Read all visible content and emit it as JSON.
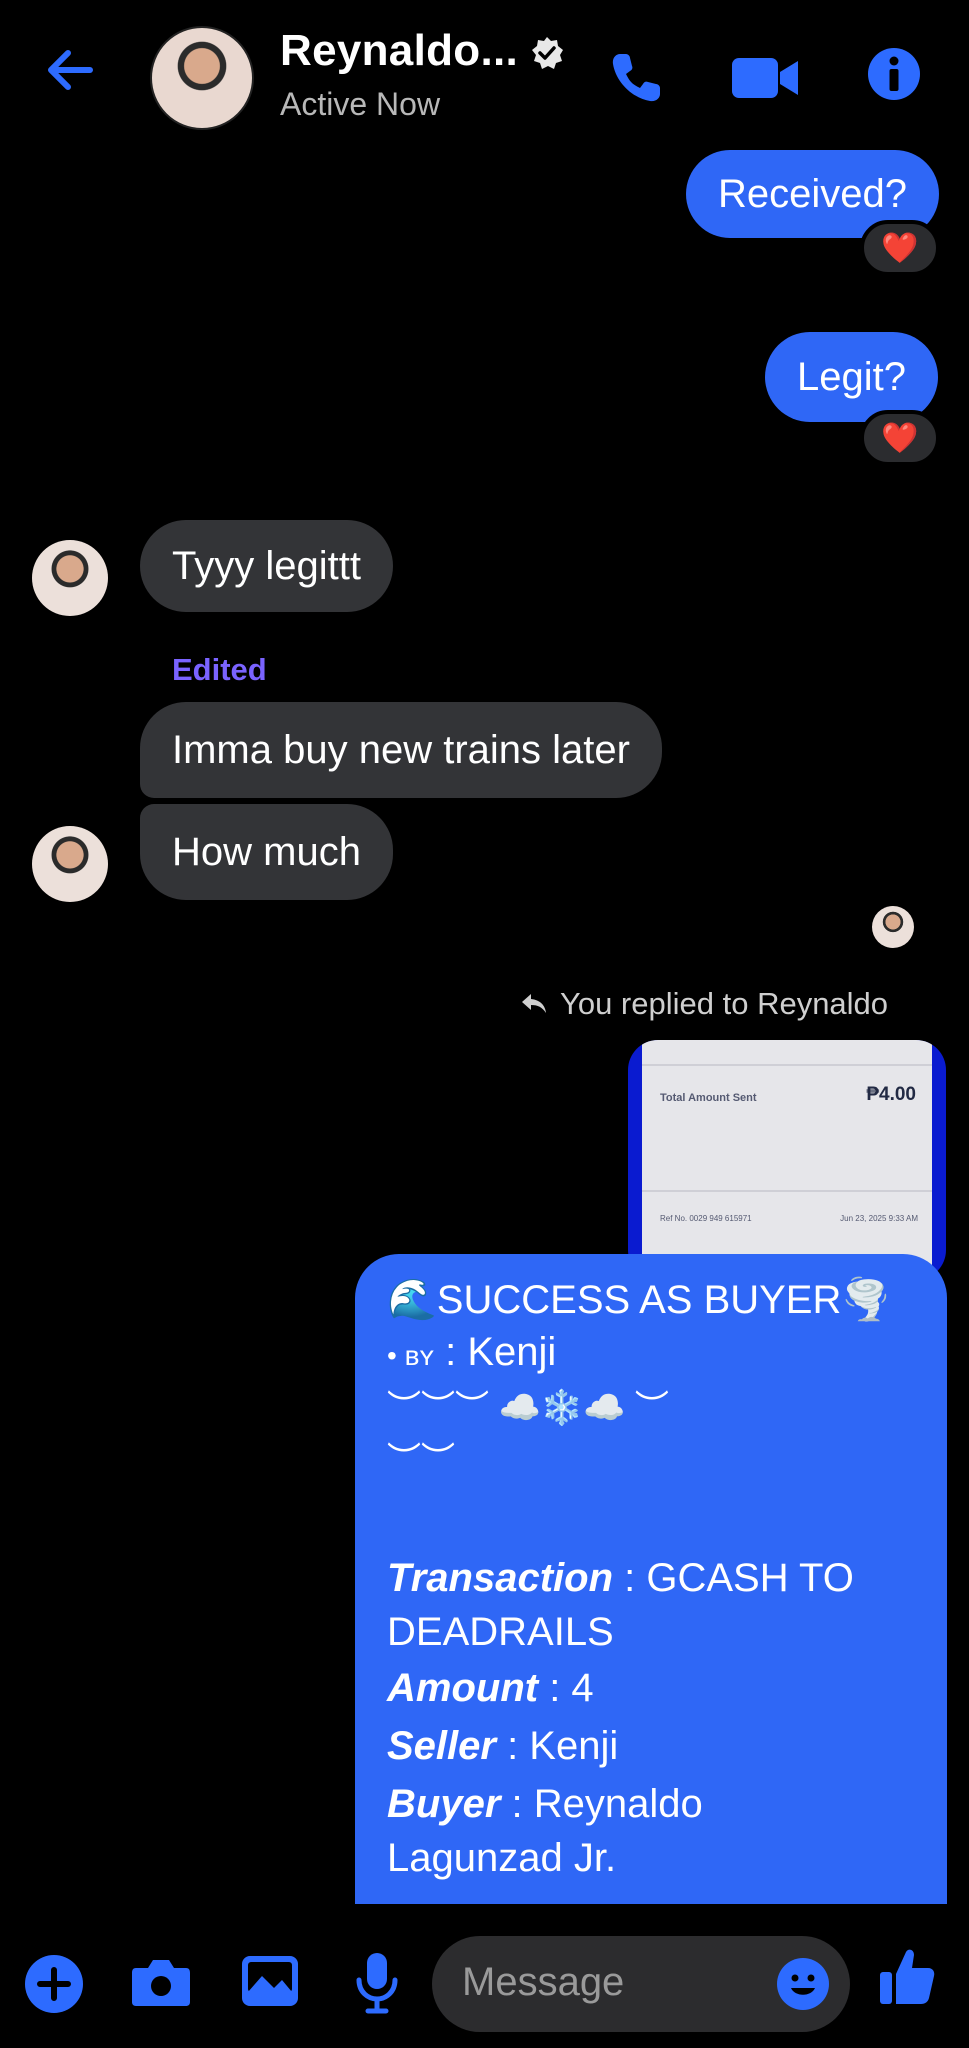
{
  "header": {
    "title": "Reynaldo...",
    "status": "Active Now"
  },
  "messages": {
    "out_1": "Received?",
    "out_2": "Legit?",
    "in_1": "Tyyy legittt",
    "edited_label": "Edited",
    "in_2": "Imma buy new trains later",
    "in_3": "How much",
    "reaction": "❤️",
    "reply_label": "You replied to Reynaldo"
  },
  "reply_preview": {
    "total_label": "Total Amount Sent",
    "amount": "₱4.00",
    "ref": "Ref No. 0029 949 615971",
    "date": "Jun 23, 2025 9:33 AM"
  },
  "big_message": {
    "line1": "🌊SUCCESS AS BUYER🌪️",
    "by_prefix": "• ʙʏ",
    "by_value": " : Kenji",
    "decor1": "︶︶︶ ☁️❄️☁️ ︶",
    "decor2": "︶︶",
    "transaction_label": "Transaction",
    "transaction_value": " : GCASH TO",
    "transaction_value2": "DEADRAILS",
    "amount_label": "Amount",
    "amount_value": " : 4",
    "seller_label": "Seller",
    "seller_value": " : Kenji",
    "buyer_label": "Buyer",
    "buyer_value": " : Reynaldo",
    "buyer_value2": "Lagunzad Jr."
  },
  "composer": {
    "placeholder": "Message"
  },
  "colors": {
    "accent": "#2d6bff",
    "outgoing_bubble": "#2f67f6",
    "incoming_bubble": "#333437",
    "edited": "#7a63ff"
  }
}
